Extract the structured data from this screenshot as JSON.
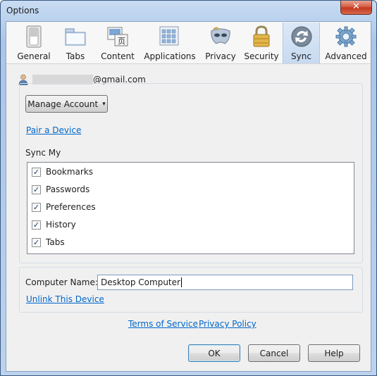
{
  "window": {
    "title": "Options",
    "close_label": "✕"
  },
  "tabs": [
    {
      "label": "General",
      "icon": "switch-icon"
    },
    {
      "label": "Tabs",
      "icon": "folder-tabs-icon"
    },
    {
      "label": "Content",
      "icon": "content-icon"
    },
    {
      "label": "Applications",
      "icon": "applications-icon"
    },
    {
      "label": "Privacy",
      "icon": "mask-icon"
    },
    {
      "label": "Security",
      "icon": "padlock-icon"
    },
    {
      "label": "Sync",
      "icon": "sync-icon",
      "active": true
    },
    {
      "label": "Advanced",
      "icon": "gear-icon"
    }
  ],
  "account": {
    "email_domain": "@gmail.com"
  },
  "manage_account": {
    "label": "Manage Account",
    "arrow": "▾"
  },
  "pair_device": {
    "label": "Pair a Device"
  },
  "sync_my": {
    "heading": "Sync My",
    "items": [
      {
        "label": "Bookmarks",
        "checked": true
      },
      {
        "label": "Passwords",
        "checked": true
      },
      {
        "label": "Preferences",
        "checked": true
      },
      {
        "label": "History",
        "checked": true
      },
      {
        "label": "Tabs",
        "checked": true
      }
    ]
  },
  "computer_name": {
    "label": "Computer Name:",
    "value": "Desktop Computer"
  },
  "unlink": {
    "label": "Unlink This Device"
  },
  "footer_links": {
    "terms": "Terms of Service",
    "privacy": "Privacy Policy"
  },
  "buttons": {
    "ok": "OK",
    "cancel": "Cancel",
    "help": "Help"
  },
  "colors": {
    "link": "#0066cc",
    "active_tab": "#c7daf1"
  }
}
